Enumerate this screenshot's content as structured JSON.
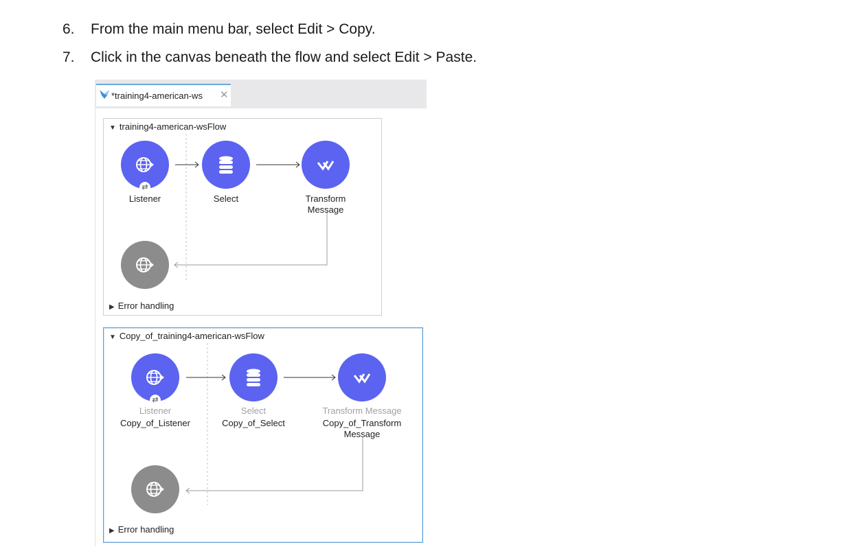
{
  "instructions": [
    {
      "number": "6.",
      "text": "From the main menu bar, select Edit > Copy."
    },
    {
      "number": "7.",
      "text": "Click in the canvas beneath the flow and select Edit > Paste."
    }
  ],
  "editor_tab": {
    "title": "*training4-american-ws",
    "logo_icon": "mulesoft-logo-icon",
    "close_icon": "close-icon"
  },
  "flows": [
    {
      "name": "training4-american-wsFlow",
      "nodes": [
        {
          "label": "Listener",
          "icon": "http-listener-icon",
          "badge": "⇄"
        },
        {
          "label": "Select",
          "icon": "database-icon"
        },
        {
          "label_line1": "Transform",
          "label_line2": "Message",
          "icon": "dataweave-icon"
        }
      ],
      "error_handler": {
        "icon": "http-response-icon"
      },
      "error_handling": "Error handling"
    },
    {
      "name": "Copy_of_training4-american-wsFlow",
      "nodes": [
        {
          "type": "Listener",
          "label": "Copy_of_Listener",
          "icon": "http-listener-icon",
          "badge": "⇄"
        },
        {
          "type": "Select",
          "label": "Copy_of_Select",
          "icon": "database-icon"
        },
        {
          "type": "Transform Message",
          "label_line1": "Copy_of_Transform",
          "label_line2": "Message",
          "icon": "dataweave-icon"
        }
      ],
      "error_handler": {
        "icon": "http-response-icon"
      },
      "error_handling": "Error handling"
    }
  ],
  "colors": {
    "node_blue": "#5b63f0",
    "node_grey": "#8c8c8c",
    "selection_border": "#5d9fd6",
    "tab_accent": "#6aa9dc"
  }
}
